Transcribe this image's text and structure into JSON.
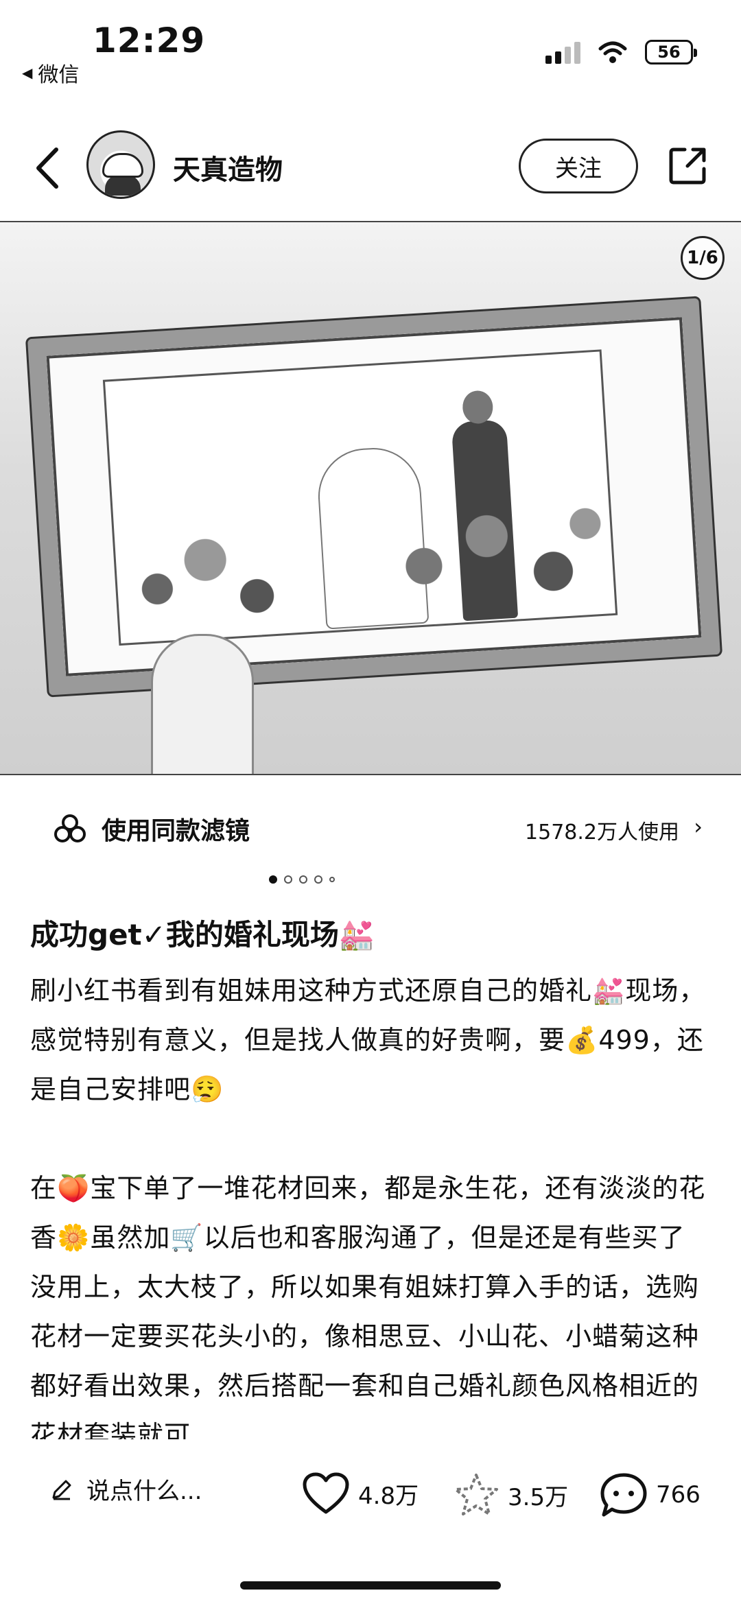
{
  "status_bar": {
    "time": "12:29",
    "back_app": "微信",
    "battery": "56"
  },
  "header": {
    "username": "天真造物",
    "follow_label": "关注"
  },
  "carousel": {
    "page_indicator": "1/6",
    "total": 6,
    "current": 1
  },
  "filter": {
    "label": "使用同款滤镜",
    "count": "1578.2万人使用"
  },
  "post": {
    "title": "成功get✓我的婚礼现场💒",
    "paragraphs": [
      "刷小红书看到有姐妹用这种方式还原自己的婚礼💒现场，感觉特别有意义，但是找人做真的好贵啊，要💰499，还是自己安排吧😮‍💨",
      "在🍑宝下单了一堆花材回来，都是永生花，还有淡淡的花香🌼虽然加🛒以后也和客服沟通了，但是还是有些买了没用上，太大枝了，所以如果有姐妹打算入手的话，选购花材一定要买花头小的，像相思豆、小山花、小蜡菊这种都好看出效果，然后搭配一套和自己婚礼颜色风格相近的花材套装就可"
    ]
  },
  "actions": {
    "comment_placeholder": "说点什么...",
    "likes": "4.8万",
    "collects": "3.5万",
    "comments": "766"
  },
  "icons": {
    "back": "chevron-left-icon",
    "share": "share-icon",
    "filter": "filter-icon",
    "edit": "pencil-icon",
    "like": "heart-icon",
    "collect": "star-icon",
    "comment": "comment-bubble-icon"
  }
}
